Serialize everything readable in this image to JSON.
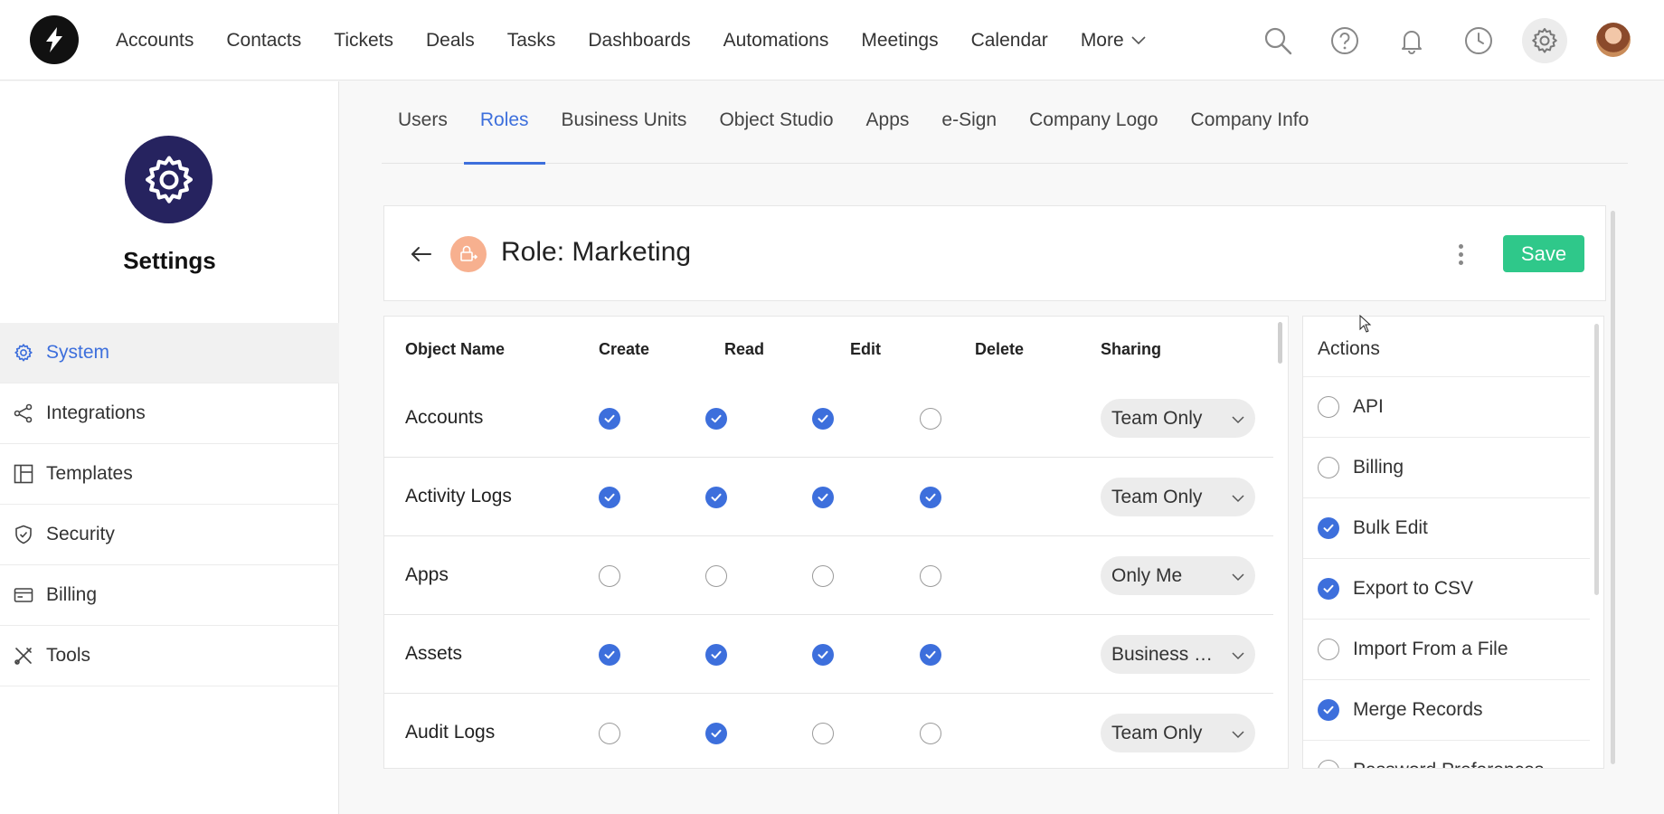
{
  "topnav": {
    "items": [
      {
        "label": "Accounts"
      },
      {
        "label": "Contacts"
      },
      {
        "label": "Tickets"
      },
      {
        "label": "Deals"
      },
      {
        "label": "Tasks"
      },
      {
        "label": "Dashboards"
      },
      {
        "label": "Automations"
      },
      {
        "label": "Meetings"
      },
      {
        "label": "Calendar"
      },
      {
        "label": "More"
      }
    ],
    "icons": [
      "search-icon",
      "help-icon",
      "bell-icon",
      "clock-icon",
      "gear-icon",
      "avatar"
    ]
  },
  "sidebar": {
    "title": "Settings",
    "items": [
      {
        "label": "System",
        "icon": "gear-icon",
        "active": true
      },
      {
        "label": "Integrations",
        "icon": "share-icon"
      },
      {
        "label": "Templates",
        "icon": "layout-icon"
      },
      {
        "label": "Security",
        "icon": "shield-icon"
      },
      {
        "label": "Billing",
        "icon": "card-icon"
      },
      {
        "label": "Tools",
        "icon": "tools-icon"
      }
    ]
  },
  "tabs": [
    {
      "label": "Users"
    },
    {
      "label": "Roles",
      "active": true
    },
    {
      "label": "Business Units"
    },
    {
      "label": "Object Studio"
    },
    {
      "label": "Apps"
    },
    {
      "label": "e-Sign"
    },
    {
      "label": "Company Logo"
    },
    {
      "label": "Company Info"
    }
  ],
  "role": {
    "title": "Role: Marketing",
    "save_label": "Save"
  },
  "permissions": {
    "headers": {
      "object_name": "Object Name",
      "create": "Create",
      "read": "Read",
      "edit": "Edit",
      "delete": "Delete",
      "sharing": "Sharing"
    },
    "rows": [
      {
        "name": "Accounts",
        "create": true,
        "read": true,
        "edit": true,
        "delete": false,
        "sharing": "Team Only"
      },
      {
        "name": "Activity Logs",
        "create": true,
        "read": true,
        "edit": true,
        "delete": true,
        "sharing": "Team Only"
      },
      {
        "name": "Apps",
        "create": false,
        "read": false,
        "edit": false,
        "delete": false,
        "sharing": "Only Me"
      },
      {
        "name": "Assets",
        "create": true,
        "read": true,
        "edit": true,
        "delete": true,
        "sharing": "Business Unit"
      },
      {
        "name": "Audit Logs",
        "create": false,
        "read": true,
        "edit": false,
        "delete": false,
        "sharing": "Team Only"
      }
    ]
  },
  "actions": {
    "title": "Actions",
    "items": [
      {
        "label": "API",
        "checked": false
      },
      {
        "label": "Billing",
        "checked": false
      },
      {
        "label": "Bulk Edit",
        "checked": true
      },
      {
        "label": "Export to CSV",
        "checked": true
      },
      {
        "label": "Import From a File",
        "checked": false
      },
      {
        "label": "Merge Records",
        "checked": true
      },
      {
        "label": "Password Preferences",
        "checked": false
      }
    ]
  },
  "colors": {
    "accent": "#3d6fdc",
    "save": "#2fc88a",
    "settings_badge": "#26235f",
    "role_icon": "#f7b08f"
  }
}
